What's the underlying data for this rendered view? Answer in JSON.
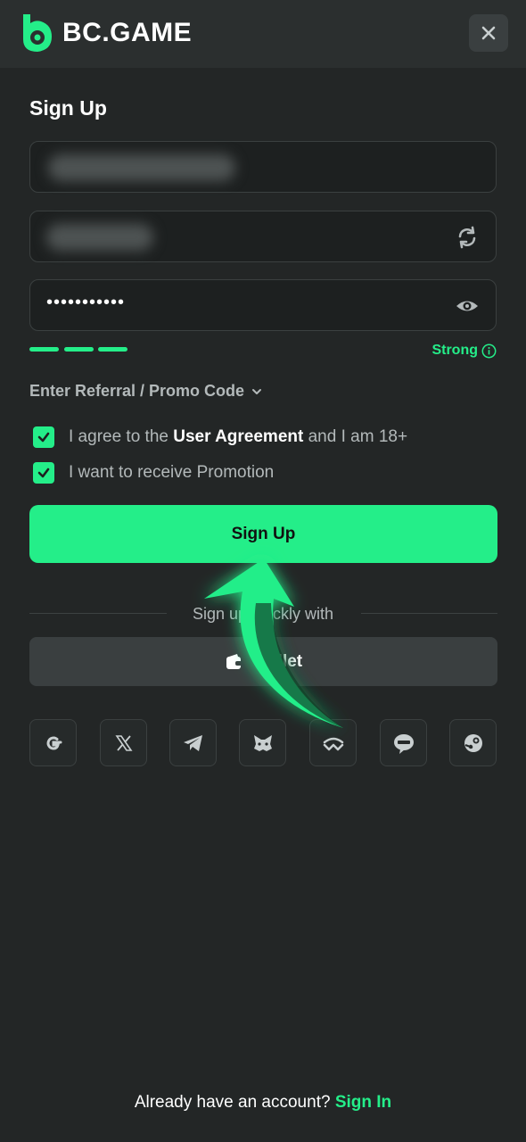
{
  "header": {
    "brand": "BC.GAME",
    "icons": {
      "logo": "bc-game-logo",
      "close": "close-icon"
    }
  },
  "form": {
    "title": "Sign Up",
    "email_field": {
      "value": ""
    },
    "username_field": {
      "value": "",
      "icon": "refresh-icon"
    },
    "password_field": {
      "value": "•••••••••••",
      "icon": "eye-icon"
    },
    "strength": {
      "label": "Strong",
      "icon": "info-icon",
      "segments_filled": 3
    },
    "referral": {
      "label": "Enter Referral / Promo Code",
      "icon": "chevron-down-icon"
    },
    "agreements": [
      {
        "checked": true,
        "text_before": "I agree to the ",
        "link": "User Agreement",
        "text_after": " and I am 18+"
      },
      {
        "checked": true,
        "text_before": "I want to receive Promotion",
        "link": "",
        "text_after": ""
      }
    ],
    "submit_label": "Sign Up"
  },
  "alt_signup": {
    "divider_text": "Sign up quickly with",
    "wallet_label": "Wallet",
    "wallet_icon": "wallet-icon",
    "social_icons": [
      "google-icon",
      "x-icon",
      "telegram-icon",
      "metamask-icon",
      "walletconnect-icon",
      "line-icon",
      "steam-icon"
    ]
  },
  "footer": {
    "prompt": "Already have an account? ",
    "link": "Sign In"
  },
  "colors": {
    "accent": "#24ee89",
    "background": "#232626",
    "header_bg": "#2b2f2f",
    "field_bg": "#1d2020"
  }
}
